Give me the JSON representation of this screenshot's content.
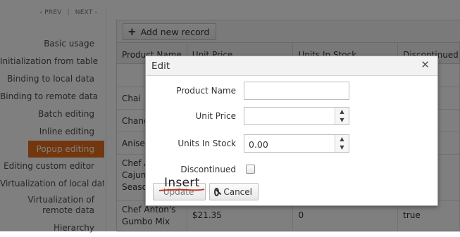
{
  "pager": {
    "prev": "PREV",
    "next": "NEXT"
  },
  "nav": {
    "items": [
      {
        "label": "Basic usage"
      },
      {
        "label": "Initialization from table"
      },
      {
        "label": "Binding to local data"
      },
      {
        "label": "Binding to remote data"
      },
      {
        "label": "Batch editing"
      },
      {
        "label": "Inline editing"
      },
      {
        "label": "Popup editing",
        "active": true
      },
      {
        "label": "Editing custom editor"
      },
      {
        "label": "Virtualization of local data"
      },
      {
        "label": "Virtualization of remote data"
      },
      {
        "label": "Hierarchy"
      }
    ]
  },
  "grid": {
    "add_label": "Add new record",
    "columns": [
      "Product Name",
      "Unit Price",
      "Units In Stock",
      "Discontinued"
    ],
    "rows": [
      {
        "name": "",
        "price": "",
        "stock": "",
        "disc": ""
      },
      {
        "name": "Chai",
        "price": "",
        "stock": "",
        "disc": ""
      },
      {
        "name": "Chang",
        "price": "",
        "stock": "",
        "disc": ""
      },
      {
        "name": "Aniseed",
        "price": "",
        "stock": "",
        "disc": ""
      },
      {
        "name": "Chef Anton's Cajun Seasoning",
        "price": "",
        "stock": "",
        "disc": ""
      },
      {
        "name": "Chef Anton's Gumbo Mix",
        "price": "$21.35",
        "stock": "0",
        "disc": "true"
      }
    ]
  },
  "dialog": {
    "title": "Edit",
    "fields": {
      "product_name": {
        "label": "Product Name",
        "value": ""
      },
      "unit_price": {
        "label": "Unit Price",
        "value": ""
      },
      "units_in_stock": {
        "label": "Units In Stock",
        "value": "0.00"
      },
      "discontinued": {
        "label": "Discontinued",
        "checked": false
      }
    },
    "update_label": "Update",
    "cancel_label": "Cancel"
  },
  "annotation": {
    "text": "Insert"
  },
  "colors": {
    "accent": "#e56f18",
    "annotation_strike": "#c0392b"
  }
}
